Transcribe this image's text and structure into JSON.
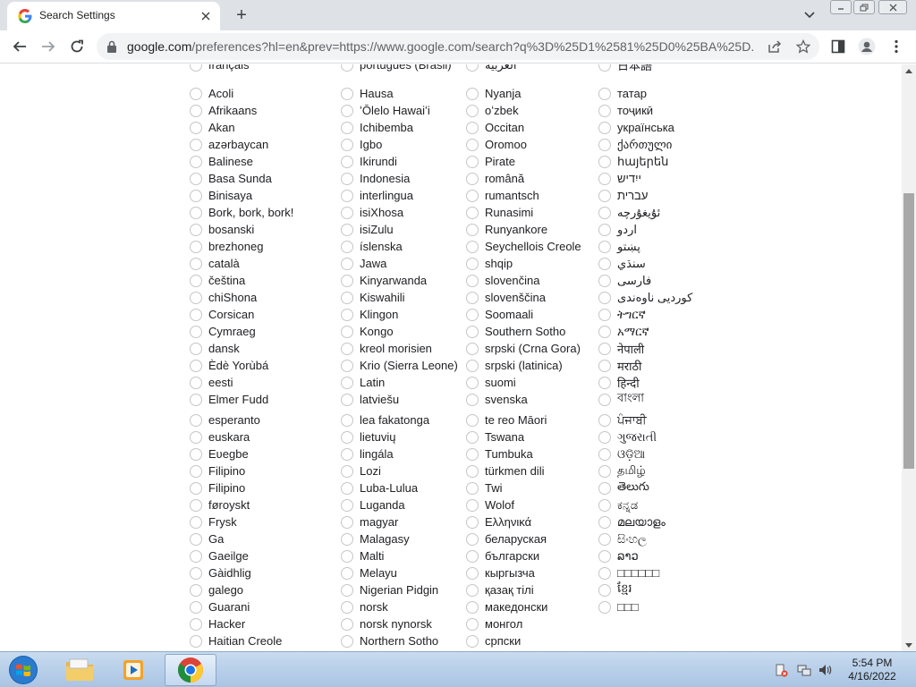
{
  "browser": {
    "tab_title": "Search Settings",
    "new_tab_symbol": "+",
    "url_host": "google.com",
    "url_rest": "/preferences?hl=en&prev=https://www.google.com/search?q%3D%25D1%2581%25D0%25BA%25D...",
    "window_controls": [
      "minimize",
      "restore",
      "close"
    ]
  },
  "icons": {
    "favicon": "google-g-icon",
    "back": "back-arrow-icon",
    "forward": "forward-arrow-icon",
    "reload": "reload-icon",
    "lock": "lock-icon",
    "share": "share-icon",
    "bookmark": "star-icon",
    "sidepanel": "side-panel-icon",
    "profile": "profile-icon",
    "menu": "kebab-menu-icon"
  },
  "languages": {
    "partial_top_row": [
      "français",
      "português (Brasil)",
      "العربية",
      "日本語"
    ],
    "columns": [
      [
        "Acoli",
        "Afrikaans",
        "Akan",
        "azərbaycan",
        "Balinese",
        "Basa Sunda",
        "Binisaya",
        "Bork, bork, bork!",
        "bosanski",
        "brezhoneg",
        "català",
        "čeština",
        "chiShona",
        "Corsican",
        "Cymraeg",
        "dansk",
        "Èdè Yorùbá",
        "eesti",
        "Elmer Fudd",
        "esperanto",
        "euskara",
        "Eʋegbe",
        "Filipino",
        "Filipino",
        "føroyskt",
        "Frysk",
        "Ga",
        "Gaeilge",
        "Gàidhlig",
        "galego",
        "Guarani",
        "Hacker",
        "Haitian Creole"
      ],
      [
        "Hausa",
        "ʻŌlelo Hawaiʻi",
        "Ichibemba",
        "Igbo",
        "Ikirundi",
        "Indonesia",
        "interlingua",
        "isiXhosa",
        "isiZulu",
        "íslenska",
        "Jawa",
        "Kinyarwanda",
        "Kiswahili",
        "Klingon",
        "Kongo",
        "kreol morisien",
        "Krio (Sierra Leone)",
        "Latin",
        "latviešu",
        "lea fakatonga",
        "lietuvių",
        "lingála",
        "Lozi",
        "Luba-Lulua",
        "Luganda",
        "magyar",
        "Malagasy",
        "Malti",
        "Melayu",
        "Nigerian Pidgin",
        "norsk",
        "norsk nynorsk",
        "Northern Sotho"
      ],
      [
        "Nyanja",
        "oʻzbek",
        "Occitan",
        "Oromoo",
        "Pirate",
        "română",
        "rumantsch",
        "Runasimi",
        "Runyankore",
        "Seychellois Creole",
        "shqip",
        "slovenčina",
        "slovenščina",
        "Soomaali",
        "Southern Sotho",
        "srpski (Crna Gora)",
        "srpski (latinica)",
        "suomi",
        "svenska",
        "te reo Māori",
        "Tswana",
        "Tumbuka",
        "türkmen dili",
        "Twi",
        "Wolof",
        "Ελληνικά",
        "беларуская",
        "български",
        "кыргызча",
        "қазақ тілі",
        "македонски",
        "монгол",
        "српски"
      ],
      [
        "татар",
        "тоҷикӣ",
        "українська",
        "ქართული",
        "հայերեն",
        "ייִדיש",
        "עברית",
        "ئۇيغۇرچە",
        "اردو",
        "پښتو",
        "سنڌي",
        "فارسی",
        "کوردیی ناوەندی",
        "ትግርኛ",
        "አማርኛ",
        "नेपाली",
        "मराठी",
        "हिन्दी",
        "বাংলা",
        "ਪੰਜਾਬੀ",
        "ગુજરાતી",
        "ଓଡ଼ିଆ",
        "தமிழ்",
        "తెలుగు",
        "ಕನ್ನಡ",
        "മലയാളം",
        "සිංහල",
        "ລາວ",
        "□□□□□□",
        "ខ្មែរ",
        "□□□"
      ]
    ]
  },
  "taskbar": {
    "apps": [
      "file-explorer",
      "media-player",
      "chrome"
    ],
    "clock_time": "5:54 PM",
    "clock_date": "4/16/2022"
  },
  "colors": {
    "tabstrip": "#dee1e6",
    "taskbar": "#b9d0ea",
    "text": "#202124"
  }
}
